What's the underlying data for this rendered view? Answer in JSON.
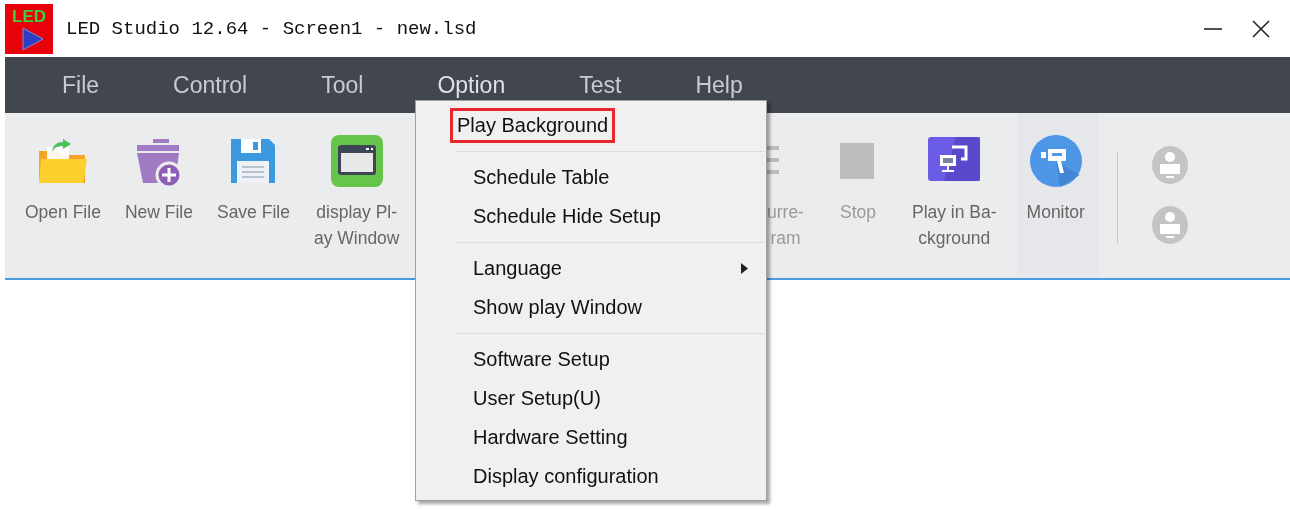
{
  "window": {
    "title": "LED Studio 12.64 - Screen1 - new.lsd",
    "logo_text": "LED"
  },
  "menu_bar": [
    {
      "label": "File",
      "selected": false
    },
    {
      "label": "Control",
      "selected": false
    },
    {
      "label": "Tool",
      "selected": false
    },
    {
      "label": "Option",
      "selected": true
    },
    {
      "label": "Test",
      "selected": false
    },
    {
      "label": "Help",
      "selected": false
    }
  ],
  "toolbar": {
    "left_items": [
      {
        "kind": "open",
        "label": "Open File",
        "disabled": false
      },
      {
        "kind": "new",
        "label": "New File",
        "disabled": false
      },
      {
        "kind": "save",
        "label": "Save File",
        "disabled": false
      },
      {
        "kind": "window",
        "label": "display Pl-\nay Window",
        "disabled": false
      }
    ],
    "right_items": [
      {
        "kind": "list",
        "label": "urre-\nram",
        "disabled": true
      },
      {
        "kind": "stop",
        "label": "Stop",
        "disabled": true
      },
      {
        "kind": "background",
        "label": "Play in Ba-\nckground",
        "disabled": false
      },
      {
        "kind": "monitor",
        "label": "Monitor",
        "disabled": false
      }
    ],
    "screen_buttons": [
      {
        "disabled": true
      },
      {
        "disabled": true
      }
    ]
  },
  "option_menu": [
    {
      "kind": "item",
      "label": "Play Background",
      "highlighted": true
    },
    {
      "kind": "separator"
    },
    {
      "kind": "item",
      "label": "Schedule Table",
      "highlighted": false
    },
    {
      "kind": "item",
      "label": "Schedule Hide Setup",
      "highlighted": false
    },
    {
      "kind": "separator"
    },
    {
      "kind": "submenu",
      "label": "Language",
      "highlighted": false
    },
    {
      "kind": "item",
      "label": "Show play Window",
      "highlighted": false
    },
    {
      "kind": "separator"
    },
    {
      "kind": "item",
      "label": "Software Setup",
      "highlighted": false
    },
    {
      "kind": "item",
      "label": "User Setup(U)",
      "highlighted": false
    },
    {
      "kind": "item",
      "label": "Hardware Setting",
      "highlighted": false
    },
    {
      "kind": "item",
      "label": "Display configuration",
      "highlighted": false
    }
  ]
}
